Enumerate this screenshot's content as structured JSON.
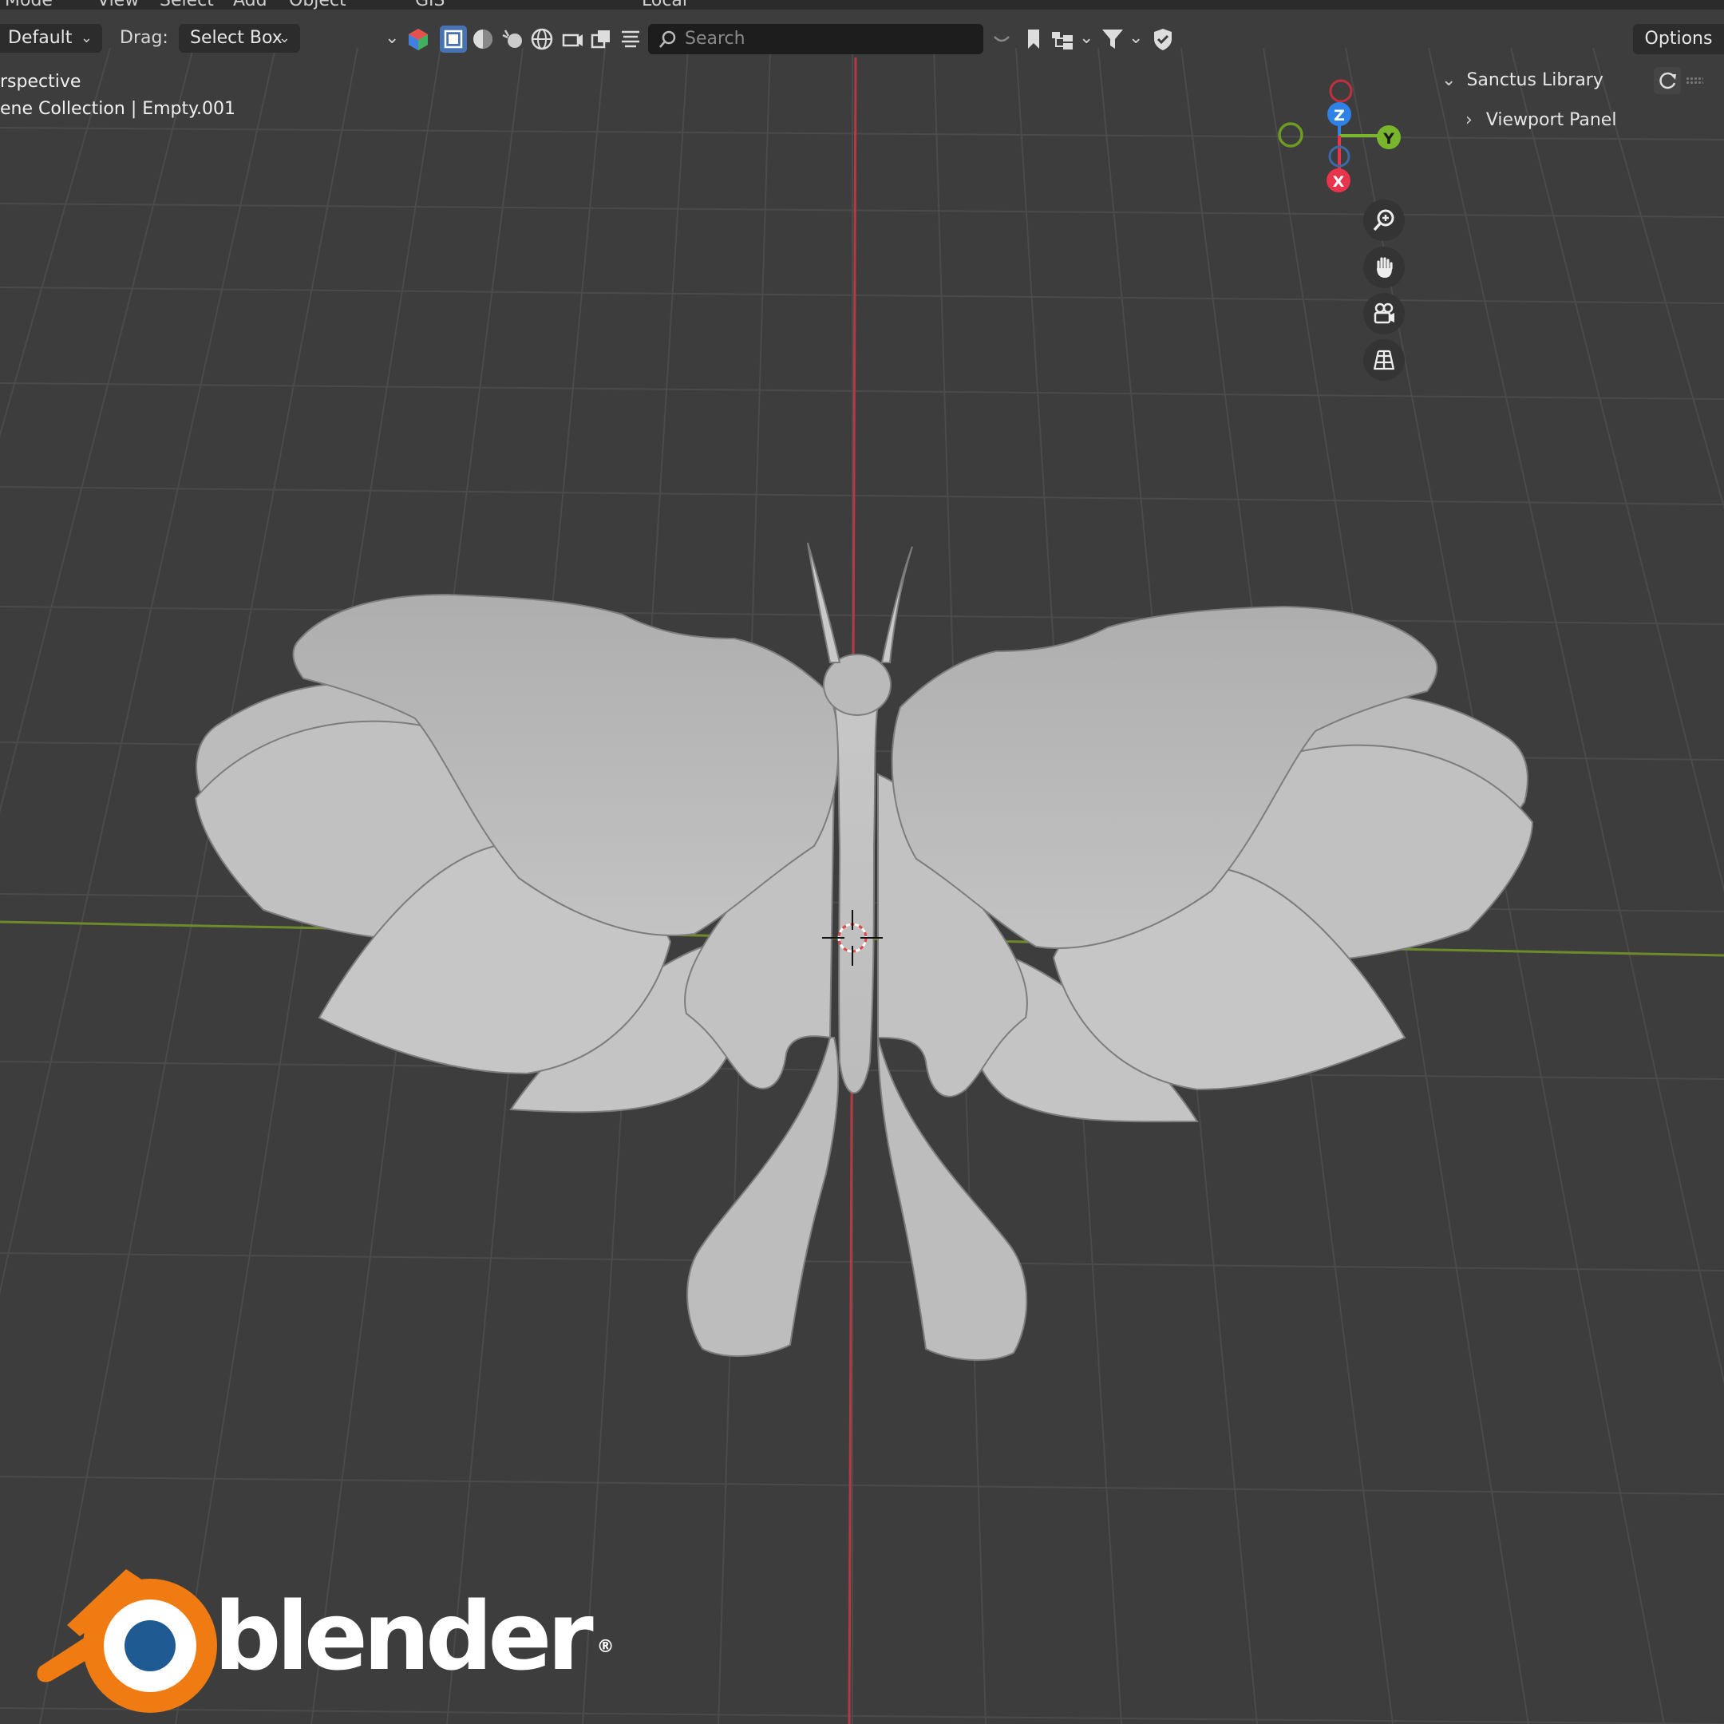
{
  "header": {
    "menus": [
      "Mode",
      "View",
      "Select",
      "Add",
      "Object",
      "GIS"
    ],
    "pivot_label": "Local",
    "orientation": "Default",
    "drag_label": "Drag:",
    "drag_mode": "Select Box",
    "search_placeholder": "Search",
    "options_label": "Options"
  },
  "overlay": {
    "view_name": "rspective",
    "collection_line": "ene Collection | Empty.001"
  },
  "side_panel": {
    "library_label": "Sanctus Library",
    "viewport_panel_label": "Viewport Panel"
  },
  "gizmo": {
    "z_label": "Z",
    "y_label": "Y",
    "x_label": "X",
    "colors": {
      "x": "#e8344d",
      "y": "#7ab62b",
      "z": "#2e82e6"
    }
  },
  "navigation": [
    "zoom-icon",
    "hand-pan-icon",
    "camera-icon",
    "grid-perspective-icon"
  ],
  "logo": {
    "text": "blender",
    "mark": "®"
  },
  "colors": {
    "background": "#3d3d3d",
    "grid_line": "#4a4a4a",
    "axis_red": "#b33a43",
    "axis_green": "#6f8a2a",
    "model": "#b9b9b9",
    "accent": "#4772b3",
    "logo_orange": "#f07b13",
    "logo_blue": "#1f5a93"
  }
}
